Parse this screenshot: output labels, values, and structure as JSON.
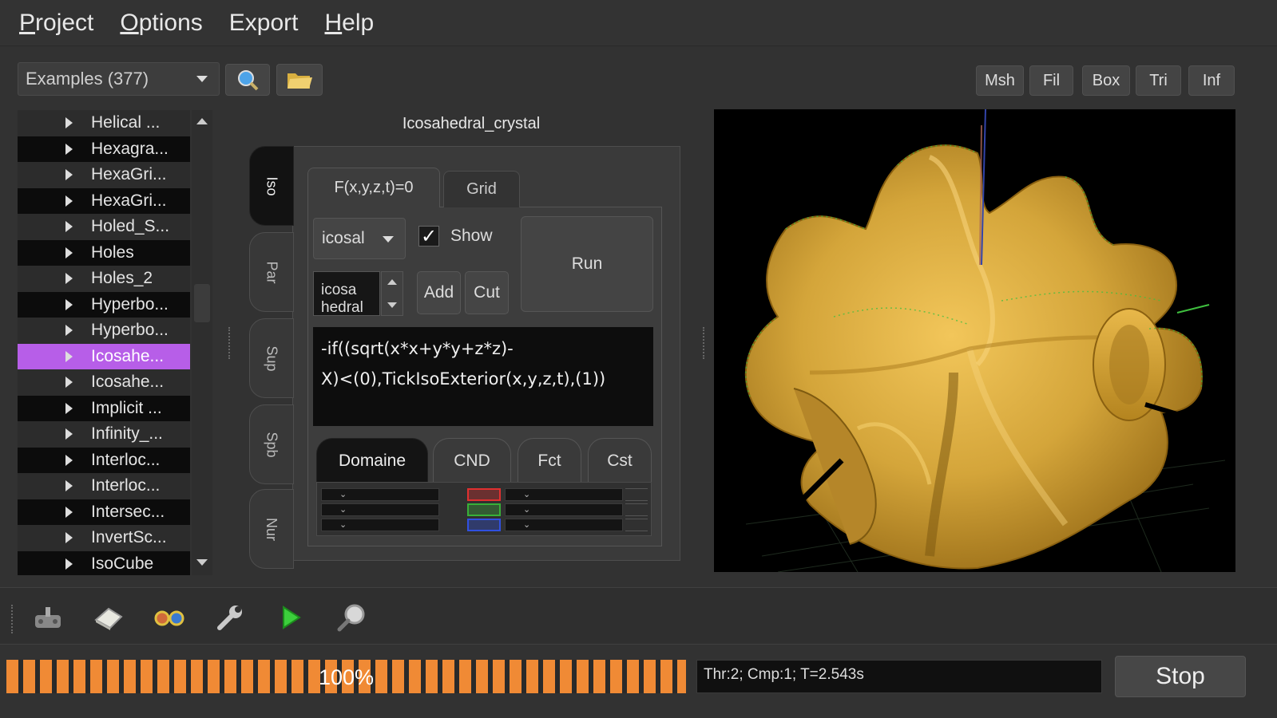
{
  "menu": {
    "items": [
      "Project",
      "Options",
      "Export",
      "Help"
    ]
  },
  "toolbar": {
    "examples_combo": "Examples (377)",
    "search_icon": "magnifier-icon",
    "open_icon": "folder-icon",
    "view_buttons": [
      "Msh",
      "Fil",
      "Box",
      "Tri",
      "Inf"
    ]
  },
  "examples_list": {
    "items": [
      {
        "label": "Helical ...",
        "style": "light"
      },
      {
        "label": "Hexagra...",
        "style": "dark"
      },
      {
        "label": "HexaGri...",
        "style": "light"
      },
      {
        "label": "HexaGri...",
        "style": "dark"
      },
      {
        "label": "Holed_S...",
        "style": "light"
      },
      {
        "label": "Holes",
        "style": "dark"
      },
      {
        "label": "Holes_2",
        "style": "light"
      },
      {
        "label": "Hyperbo...",
        "style": "dark"
      },
      {
        "label": "Hyperbo...",
        "style": "light"
      },
      {
        "label": "Icosahe...",
        "style": "sel"
      },
      {
        "label": "Icosahe...",
        "style": "light"
      },
      {
        "label": "Implicit ...",
        "style": "dark"
      },
      {
        "label": "Infinity_...",
        "style": "light"
      },
      {
        "label": "Interloc...",
        "style": "dark"
      },
      {
        "label": "Interloc...",
        "style": "light"
      },
      {
        "label": "Intersec...",
        "style": "dark"
      },
      {
        "label": "InvertSc...",
        "style": "light"
      },
      {
        "label": "IsoCube",
        "style": "dark"
      }
    ]
  },
  "editor_panel": {
    "title": "Icosahedral_crystal",
    "side_tabs": [
      "Iso",
      "Par",
      "Sup",
      "Spb",
      "Nur"
    ],
    "tabs": [
      "F(x,y,z,t)=0",
      "Grid"
    ],
    "function_select": "icosal",
    "show_checkbox": {
      "label": "Show",
      "checked": true
    },
    "run_label": "Run",
    "name_spinner": "icosa\nhedral",
    "add_label": "Add",
    "cut_label": "Cut",
    "formula_line1": "-if((sqrt(x*x+y*y+z*z)-",
    "formula_line2": "X)<(0),TickIsoExterior(x,y,z,t),(1))",
    "bottom_tabs": [
      "Domaine",
      "CND",
      "Fct",
      "Cst"
    ],
    "condition_colors": [
      "#e03030",
      "#38b038",
      "#3050e0"
    ]
  },
  "viewport": {
    "object_color": "#d4a53a",
    "background": "#000000"
  },
  "bottom_toolbar": {
    "icons": [
      "gamepad-icon",
      "eraser-icon",
      "glasses-icon",
      "wrench-icon",
      "play-icon",
      "zoom-icon"
    ]
  },
  "status": {
    "progress_text": "100%",
    "progress_fraction": 1.0,
    "info": "Thr:2; Cmp:1; T=2.543s",
    "stop_label": "Stop"
  }
}
